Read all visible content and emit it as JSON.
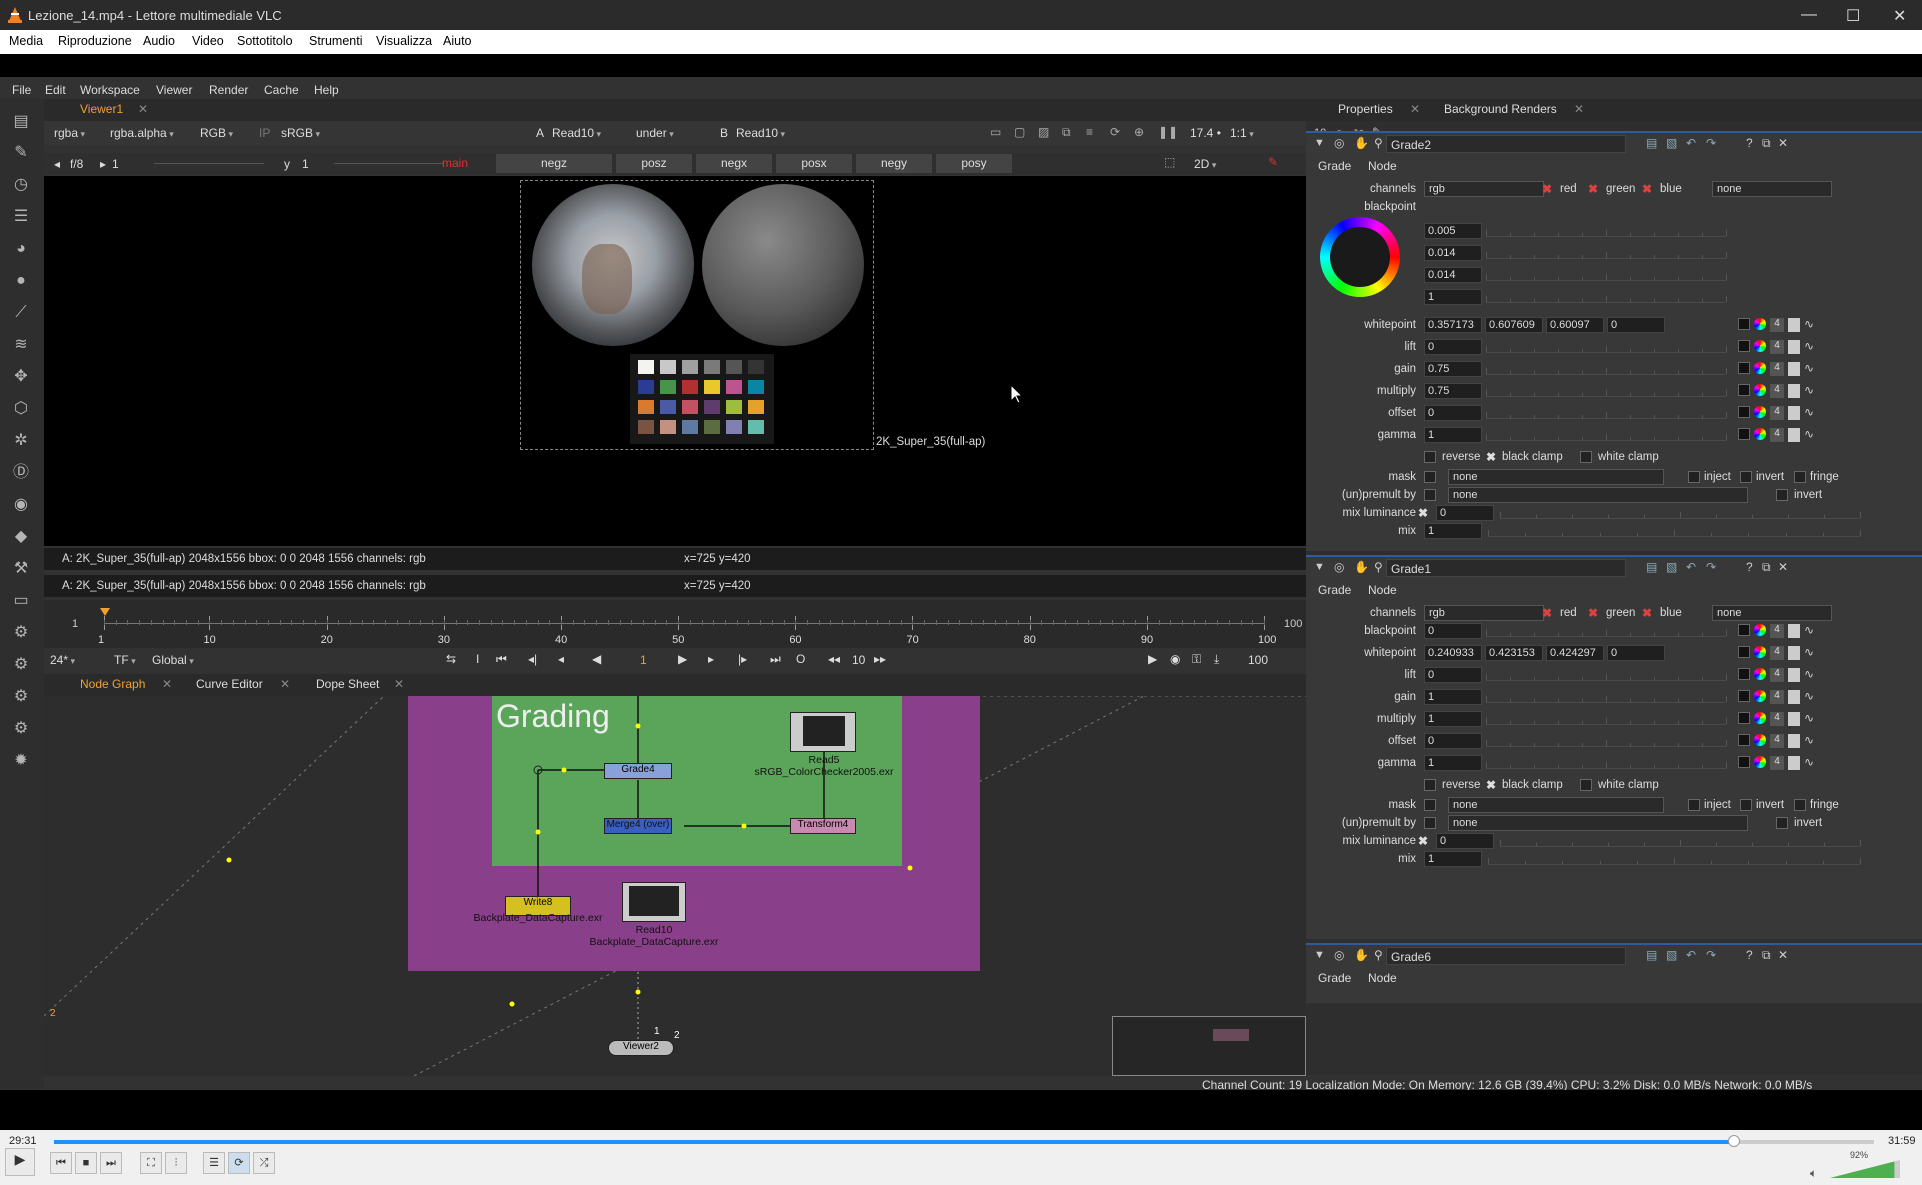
{
  "window": {
    "title": "Lezione_14.mp4 - Lettore multimediale VLC",
    "controls": [
      "—",
      "☐",
      "✕"
    ]
  },
  "vlc_menu": [
    "Media",
    "Riproduzione",
    "Audio",
    "Video",
    "Sottotitolo",
    "Strumenti",
    "Visualizza",
    "Aiuto"
  ],
  "nuke_menu": [
    "File",
    "Edit",
    "Workspace",
    "Viewer",
    "Render",
    "Cache",
    "Help"
  ],
  "viewer": {
    "tab": "Viewer1",
    "channels": "rgba",
    "alpha": "rgba.alpha",
    "rgb": "RGB",
    "ip": "IP",
    "lut": "sRGB",
    "a_label": "A",
    "a_input": "Read10",
    "composite": "under",
    "b_label": "B",
    "b_input": "Read10",
    "zoom": "17.4 •",
    "ratio": "1:1",
    "fstop": "f/8",
    "frame": "1",
    "y_label": "y",
    "y_value": "1",
    "views": [
      "main",
      "negz",
      "posz",
      "negx",
      "posx",
      "negy",
      "posy"
    ],
    "mode": "2D",
    "format_label": "2K_Super_35(full-ap)",
    "info1": "A:  2K_Super_35(full-ap) 2048x1556  bbox: 0 0 2048 1556 channels: rgb",
    "coords1": "x=725 y=420",
    "info2": "A:  2K_Super_35(full-ap) 2048x1556  bbox: 0 0 2048 1556 channels: rgb",
    "coords2": "x=725 y=420"
  },
  "timeline": {
    "ticks": [
      "1",
      "10",
      "20",
      "30",
      "40",
      "50",
      "60",
      "70",
      "80",
      "90",
      "100"
    ],
    "start": "1",
    "end": "100",
    "fps": "24*",
    "tf": "TF",
    "scope": "Global",
    "current": "1",
    "step": "10",
    "out": "100"
  },
  "graph_tabs": [
    "Node Graph",
    "Curve Editor",
    "Dope Sheet"
  ],
  "graph": {
    "backdrop": "Grading",
    "nodes": {
      "grade4": "Grade4",
      "merge4": "Merge4 (over)",
      "transform4": "Transform4",
      "read5": "Read5",
      "read5_file": "sRGB_ColorChecker2005.exr",
      "write8": "Write8",
      "write8_file": "Backplate_DataCapture.exr",
      "read10": "Read10",
      "read10_file": "Backplate_DataCapture.exr",
      "viewer2": "Viewer2",
      "pin1": "1",
      "pin2": "2",
      "pin3": "2"
    }
  },
  "status": "Channel Count: 19  Localization Mode: On  Memory: 12.6 GB (39.4%)  CPU: 3.2%  Disk: 0.0 MB/s  Network: 0.0 MB/s",
  "properties": {
    "tabs": [
      "Properties",
      "Background Renders"
    ],
    "max_panels": "10",
    "grade2": {
      "name": "Grade2",
      "subtabs": [
        "Grade",
        "Node"
      ],
      "channels": "rgb",
      "red": "red",
      "green": "green",
      "blue": "blue",
      "none": "none",
      "blackpoint_label": "blackpoint",
      "blackpoint": [
        "0.005",
        "0.014",
        "0.014",
        "1"
      ],
      "whitepoint": [
        "0.357173",
        "0.607609",
        "0.60097",
        "0"
      ],
      "lift": "0",
      "gain": "0.75",
      "multiply": "0.75",
      "offset": "0",
      "gamma": "1",
      "reverse": "reverse",
      "black_clamp": "black clamp",
      "white_clamp": "white clamp",
      "mask": "none",
      "inject": "inject",
      "invert": "invert",
      "fringe": "fringe",
      "premult": "none",
      "mix_luminance": "0",
      "mix": "1"
    },
    "grade1": {
      "name": "Grade1",
      "subtabs": [
        "Grade",
        "Node"
      ],
      "channels": "rgb",
      "red": "red",
      "green": "green",
      "blue": "blue",
      "none": "none",
      "blackpoint": "0",
      "whitepoint": [
        "0.240933",
        "0.423153",
        "0.424297",
        "0"
      ],
      "lift": "0",
      "gain": "1",
      "multiply": "1",
      "offset": "0",
      "gamma": "1",
      "reverse": "reverse",
      "black_clamp": "black clamp",
      "white_clamp": "white clamp",
      "mask": "none",
      "inject": "inject",
      "invert": "invert",
      "fringe": "fringe",
      "premult": "none",
      "mix_luminance": "0",
      "mix": "1"
    },
    "grade6": {
      "name": "Grade6",
      "subtabs": [
        "Grade",
        "Node"
      ]
    },
    "labels": {
      "channels": "channels",
      "whitepoint": "whitepoint",
      "lift": "lift",
      "gain": "gain",
      "multiply": "multiply",
      "offset": "offset",
      "gamma": "gamma",
      "mask": "mask",
      "premult": "(un)premult by",
      "mix_luminance": "mix luminance",
      "mix": "mix",
      "blackpoint": "blackpoint",
      "four": "4"
    }
  },
  "player": {
    "elapsed": "29:31",
    "total": "31:59",
    "volume": "92%",
    "progress": 0.923
  }
}
